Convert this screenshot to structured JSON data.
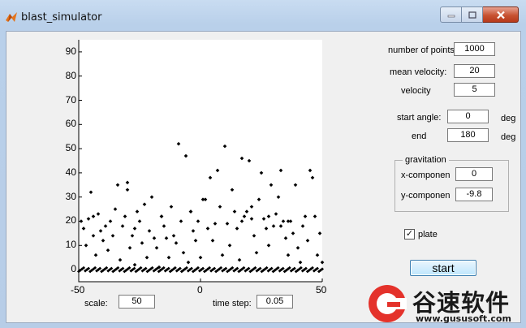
{
  "window": {
    "title": "blast_simulator",
    "controls": [
      "minimize",
      "maximize",
      "close"
    ]
  },
  "params": {
    "num_points_label": "number of points",
    "num_points_value": "1000",
    "mean_velocity_label": "mean velocity:",
    "mean_velocity_value": "20",
    "velocity_label": "velocity",
    "velocity_value": "5",
    "start_angle_label": "start angle:",
    "start_angle_value": "0",
    "start_angle_unit": "deg",
    "end_label": "end",
    "end_value": "180",
    "end_unit": "deg"
  },
  "gravitation": {
    "title": "gravitation",
    "x_label": "x-componen",
    "x_value": "0",
    "y_label": "y-componen",
    "y_value": "-9.8"
  },
  "plate": {
    "label": "plate",
    "checked": true,
    "check_glyph": "✓"
  },
  "start_button": "start",
  "bottom": {
    "scale_label": "scale:",
    "scale_value": "50",
    "time_step_label": "time step:",
    "time_step_value": "0.05"
  },
  "watermark": {
    "text": "谷速软件",
    "url": "www.gususoft.com"
  },
  "chart_data": {
    "type": "scatter",
    "title": "",
    "xlabel": "",
    "ylabel": "",
    "xlim": [
      -50,
      50
    ],
    "ylim": [
      -5,
      95
    ],
    "xticks": [
      "-50",
      "0",
      "50"
    ],
    "yticks": [
      "0",
      "10",
      "20",
      "30",
      "40",
      "50",
      "60",
      "70",
      "80",
      "90"
    ],
    "marker": "diamond",
    "color": "#000000",
    "series": [
      {
        "points": [
          [
            -49,
            20
          ],
          [
            -48,
            17
          ],
          [
            -47,
            10
          ],
          [
            -46,
            21
          ],
          [
            -45,
            32
          ],
          [
            -44,
            22
          ],
          [
            -44,
            14
          ],
          [
            -43,
            6
          ],
          [
            -42,
            23
          ],
          [
            -41,
            16
          ],
          [
            -40,
            12
          ],
          [
            -39,
            18
          ],
          [
            -38,
            8
          ],
          [
            -37,
            20
          ],
          [
            -36,
            14
          ],
          [
            -35,
            25
          ],
          [
            -34,
            35
          ],
          [
            -33,
            4
          ],
          [
            -32,
            18
          ],
          [
            -31,
            22
          ],
          [
            -30,
            36
          ],
          [
            -30,
            33
          ],
          [
            -29,
            9
          ],
          [
            -28,
            14
          ],
          [
            -27,
            2
          ],
          [
            -26,
            24
          ],
          [
            -25,
            20
          ],
          [
            -24,
            11
          ],
          [
            -23,
            27
          ],
          [
            -22,
            5
          ],
          [
            -21,
            16
          ],
          [
            -20,
            30
          ],
          [
            -19,
            13
          ],
          [
            -18,
            9
          ],
          [
            -17,
            1
          ],
          [
            -16,
            22
          ],
          [
            -15,
            18
          ],
          [
            -14,
            13
          ],
          [
            -13,
            5
          ],
          [
            -12,
            26
          ],
          [
            -11,
            14
          ],
          [
            -10,
            11
          ],
          [
            -9,
            52
          ],
          [
            -8,
            20
          ],
          [
            -7,
            7
          ],
          [
            -6,
            47
          ],
          [
            -5,
            3
          ],
          [
            -4,
            24
          ],
          [
            -3,
            16
          ],
          [
            -2,
            12
          ],
          [
            -1,
            20
          ],
          [
            0,
            5
          ],
          [
            1,
            29
          ],
          [
            2,
            29
          ],
          [
            3,
            17
          ],
          [
            4,
            38
          ],
          [
            5,
            12
          ],
          [
            6,
            19
          ],
          [
            7,
            41
          ],
          [
            8,
            26
          ],
          [
            9,
            6
          ],
          [
            10,
            51
          ],
          [
            11,
            19
          ],
          [
            12,
            10
          ],
          [
            13,
            33
          ],
          [
            14,
            24
          ],
          [
            15,
            17
          ],
          [
            16,
            4
          ],
          [
            17,
            46
          ],
          [
            18,
            22
          ],
          [
            19,
            24
          ],
          [
            20,
            45
          ],
          [
            21,
            21
          ],
          [
            22,
            14
          ],
          [
            23,
            7
          ],
          [
            24,
            29
          ],
          [
            25,
            40
          ],
          [
            26,
            21
          ],
          [
            27,
            17
          ],
          [
            28,
            10
          ],
          [
            29,
            35
          ],
          [
            30,
            18
          ],
          [
            31,
            23
          ],
          [
            32,
            30
          ],
          [
            33,
            41
          ],
          [
            34,
            20
          ],
          [
            35,
            13
          ],
          [
            36,
            6
          ],
          [
            37,
            20
          ],
          [
            38,
            15
          ],
          [
            39,
            35
          ],
          [
            40,
            9
          ],
          [
            41,
            3
          ],
          [
            42,
            18
          ],
          [
            43,
            22
          ],
          [
            44,
            12
          ],
          [
            45,
            41
          ],
          [
            46,
            38
          ],
          [
            47,
            22
          ],
          [
            48,
            6
          ],
          [
            49,
            15
          ],
          [
            50,
            3
          ],
          [
            -16,
            22
          ],
          [
            -4,
            24
          ],
          [
            17,
            20
          ],
          [
            28,
            22
          ],
          [
            33,
            18
          ],
          [
            21,
            26
          ],
          [
            -27,
            17
          ],
          [
            36,
            20
          ]
        ]
      }
    ],
    "baseline_band": {
      "y_center": 0,
      "x_range": [
        -50,
        50
      ],
      "note_points": 150
    }
  }
}
